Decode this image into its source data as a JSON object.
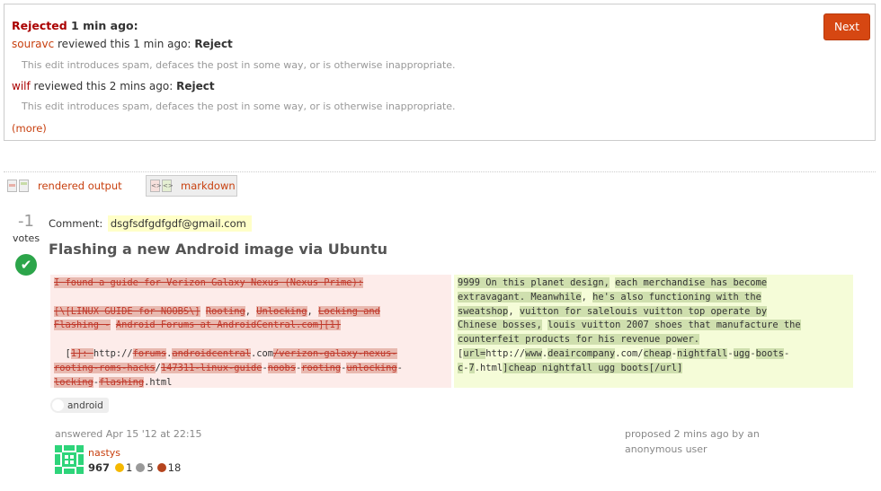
{
  "review": {
    "status_word": "Rejected",
    "status_time": "1 min ago:",
    "reviews": [
      {
        "user": "souravc",
        "text": "reviewed this 1 min ago:",
        "action": "Reject",
        "reason": "This edit introduces spam, defaces the post in some way, or is otherwise inappropriate."
      },
      {
        "user": "wilf",
        "text": "reviewed this 2 mins ago:",
        "action": "Reject",
        "reason": "This edit introduces spam, defaces the post in some way, or is otherwise inappropriate."
      }
    ],
    "more_label": "(more)",
    "next_label": "Next"
  },
  "view_tabs": {
    "rendered": "rendered output",
    "markdown": "markdown"
  },
  "post": {
    "vote_count": "-1",
    "votes_label": "votes",
    "accepted_icon": "check-icon",
    "comment_label": "Comment:",
    "comment_value": "dsgfsdfgdfgdf@gmail.com",
    "title": "Flashing a new Android image via Ubuntu",
    "tag": "android",
    "answered": "answered Apr 15 '12 at 22:15",
    "user": {
      "name": "nastys",
      "rep": "967",
      "gold": "1",
      "silver": "5",
      "bronze": "18"
    },
    "proposed": "proposed 2 mins ago by an anonymous user"
  },
  "diff": {
    "left": {
      "l1": "I found a guide for Verizon Galaxy Nexus (Nexus Prime):",
      "l2a": "[\\[LINUX GUIDE for NOOBS\\]",
      "l2b": "Rooting",
      "l2c": "Unlocking",
      "l2d": "Locking and",
      "l3a": "Flashing -",
      "l3b": "Android Forums at AndroidCentral.com][1]",
      "l4a": "1]: ",
      "l4b": "http://",
      "l4c": "forums",
      "l4d": "androidcentral",
      "l4e": ".com",
      "l4f": "/verizon-galaxy-nexus-",
      "l5a": "rooting-roms-hacks",
      "l5b": "147311-linux-guide",
      "l5c": "noobs",
      "l5d": "rooting",
      "l5e": "unlocking",
      "l6a": "locking",
      "l6b": "flashing",
      "l6c": ".html"
    },
    "right": {
      "r1a": "9999 On this planet design,",
      "r1b": "each merchandise has become ",
      "r2a": "extravagant. Meanwhile",
      "r2b": "he's also functioning with the ",
      "r3a": "sweatshop",
      "r3b": "vuitton for salelouis vuitton top ",
      "r3c": "operate by ",
      "r4a": "Chinese bosses,",
      "r4b": "louis vuitton 2007 shoes ",
      "r4c": "that manufacture the",
      "r5": "counterfeit products for his revenue power.",
      "r6a": "url=",
      "r6b": "http://",
      "r6c": "www",
      "r6d": "deaircompany",
      "r6e": ".com/",
      "r6f": "cheap",
      "r6g": "nightfall",
      "r6h": "ugg",
      "r6i": "boots",
      "r7a": "c",
      "r7b": "7",
      "r7c": ".html",
      "r7d": "]cheap nightfall ugg boots[/url]"
    }
  }
}
